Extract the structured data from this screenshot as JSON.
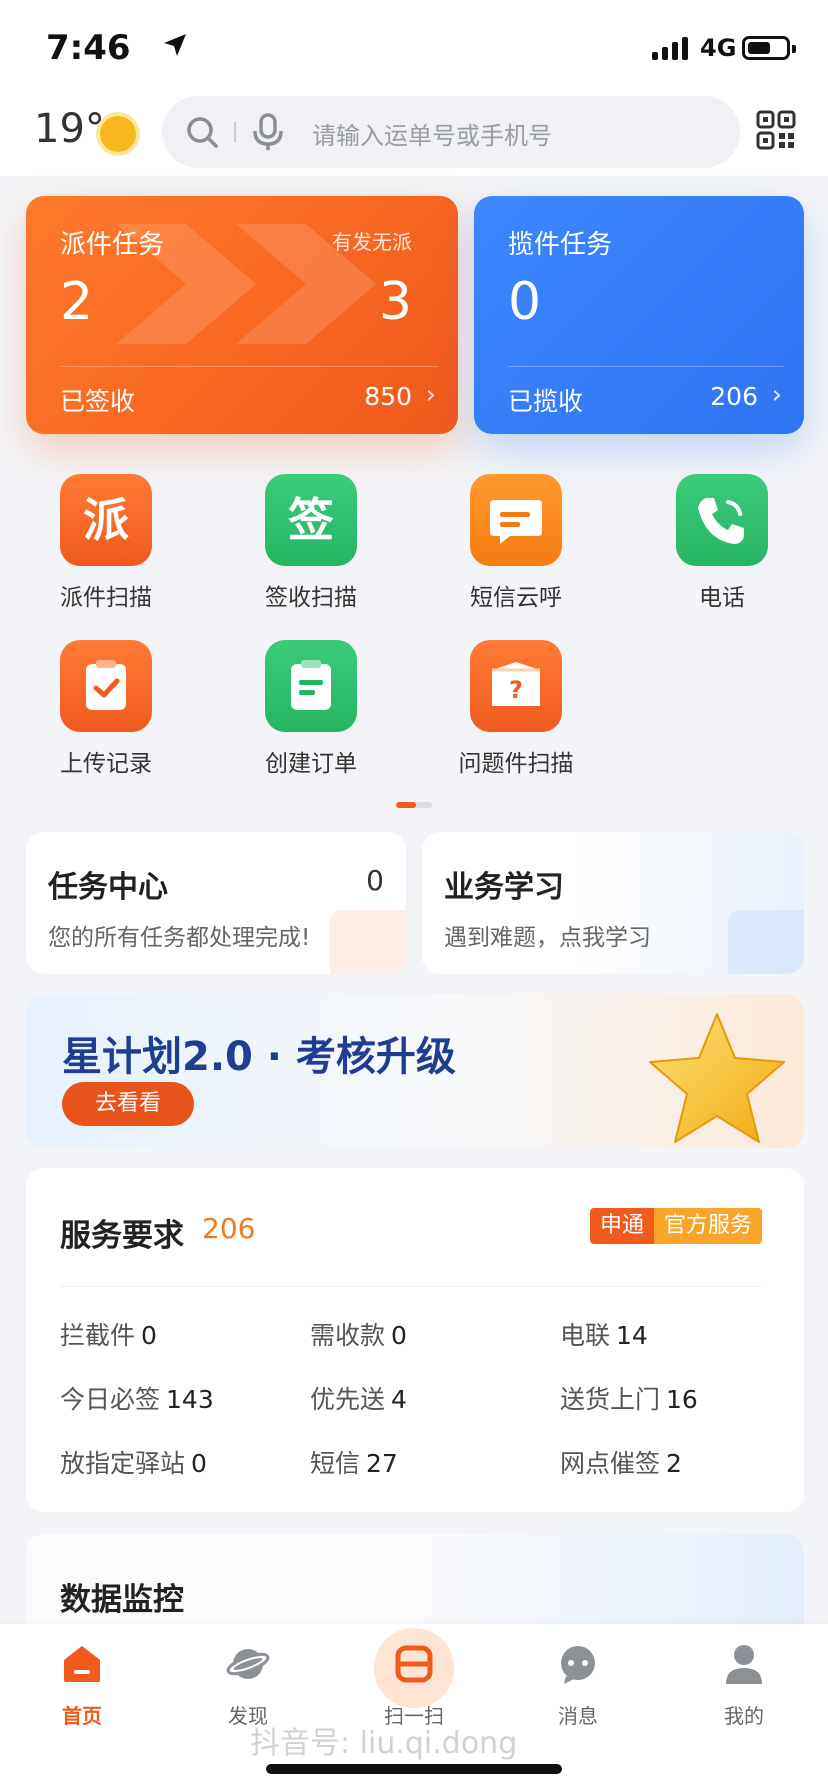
{
  "status": {
    "time": "7:46",
    "network": "4G"
  },
  "header": {
    "temperature": "19°",
    "search_placeholder": "请输入运单号或手机号"
  },
  "dispatch_card": {
    "title": "派件任务",
    "subtitle": "有发无派",
    "count": "2",
    "count_right": "3",
    "foot_label": "已签收",
    "foot_value": "850"
  },
  "pickup_card": {
    "title": "揽件任务",
    "count": "0",
    "foot_label": "已揽收",
    "foot_value": "206"
  },
  "quick_actions": [
    {
      "label": "派件扫描",
      "glyph": "派",
      "icon": "dispatch-scan-icon"
    },
    {
      "label": "签收扫描",
      "glyph": "签",
      "icon": "sign-scan-icon"
    },
    {
      "label": "短信云呼",
      "glyph": "",
      "icon": "sms-icon"
    },
    {
      "label": "电话",
      "glyph": "",
      "icon": "phone-icon"
    },
    {
      "label": "上传记录",
      "glyph": "",
      "icon": "upload-record-icon"
    },
    {
      "label": "创建订单",
      "glyph": "",
      "icon": "create-order-icon"
    },
    {
      "label": "问题件扫描",
      "glyph": "?",
      "icon": "problem-scan-icon"
    }
  ],
  "task_center": {
    "title": "任务中心",
    "count": "0",
    "desc": "您的所有任务都处理完成!"
  },
  "study": {
    "title": "业务学习",
    "desc": "遇到难题，点我学习"
  },
  "banner": {
    "title": "星计划2.0 · 考核升级",
    "button": "去看看"
  },
  "service": {
    "title": "服务要求",
    "count": "206",
    "tag_a": "申通",
    "tag_b": "官方服务",
    "items": [
      {
        "label": "拦截件",
        "value": "0"
      },
      {
        "label": "需收款",
        "value": "0"
      },
      {
        "label": "电联",
        "value": "14"
      },
      {
        "label": "今日必签",
        "value": "143"
      },
      {
        "label": "优先送",
        "value": "4"
      },
      {
        "label": "送货上门",
        "value": "16"
      },
      {
        "label": "放指定驿站",
        "value": "0"
      },
      {
        "label": "短信",
        "value": "27"
      },
      {
        "label": "网点催签",
        "value": "2"
      }
    ]
  },
  "monitor": {
    "title": "数据监控"
  },
  "tabs": [
    {
      "label": "首页",
      "icon": "home-icon"
    },
    {
      "label": "发现",
      "icon": "discover-icon"
    },
    {
      "label": "扫一扫",
      "icon": "scan-icon"
    },
    {
      "label": "消息",
      "icon": "message-icon"
    },
    {
      "label": "我的",
      "icon": "profile-icon"
    }
  ],
  "watermark": "抖音号: liu.qi.dong",
  "colors": {
    "orange": "#f05a1d",
    "blue": "#2f74f1",
    "green": "#27b563",
    "navy": "#1e3e8f"
  }
}
